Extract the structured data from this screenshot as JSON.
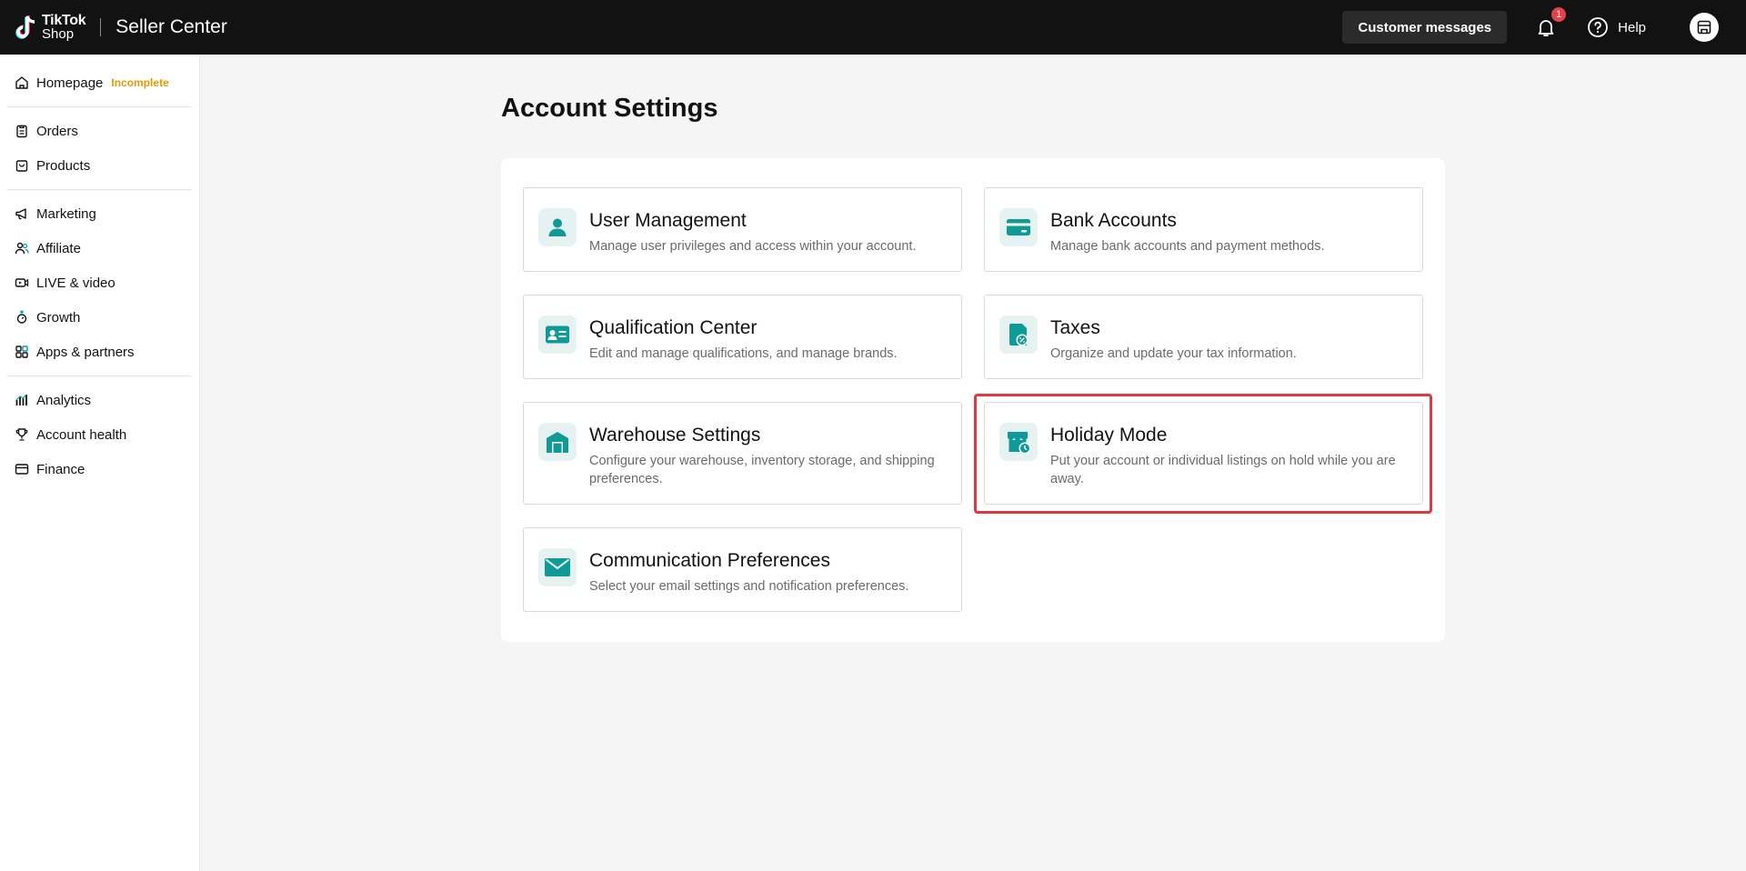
{
  "topbar": {
    "logo_line1": "TikTok",
    "logo_line2": "Shop",
    "app_title": "Seller Center",
    "customer_messages": "Customer messages",
    "notification_count": "1",
    "help": "Help"
  },
  "sidebar": {
    "homepage": "Homepage",
    "homepage_status": "Incomplete",
    "items": [
      "Orders",
      "Products",
      "Marketing",
      "Affiliate",
      "LIVE & video",
      "Growth",
      "Apps & partners",
      "Analytics",
      "Account health",
      "Finance"
    ]
  },
  "page": {
    "title": "Account Settings",
    "cards": [
      {
        "title": "User Management",
        "desc": "Manage user privileges and access within your account.",
        "icon": "user-icon"
      },
      {
        "title": "Bank Accounts",
        "desc": "Manage bank accounts and payment methods.",
        "icon": "card-icon"
      },
      {
        "title": "Qualification Center",
        "desc": "Edit and manage qualifications, and manage brands.",
        "icon": "id-card-icon"
      },
      {
        "title": "Taxes",
        "desc": "Organize and update your tax information.",
        "icon": "tax-document-icon"
      },
      {
        "title": "Warehouse Settings",
        "desc": "Configure your warehouse, inventory storage, and shipping preferences.",
        "icon": "warehouse-icon"
      },
      {
        "title": "Holiday Mode",
        "desc": "Put your account or individual listings on hold while you are away.",
        "icon": "store-clock-icon"
      },
      {
        "title": "Communication Preferences",
        "desc": "Select your email settings and notification preferences.",
        "icon": "envelope-icon"
      }
    ]
  },
  "colors": {
    "accent_teal": "#0e9a96",
    "topbar_bg": "#121212",
    "highlight_red": "#e0383e",
    "incomplete_orange": "#e39a00"
  }
}
